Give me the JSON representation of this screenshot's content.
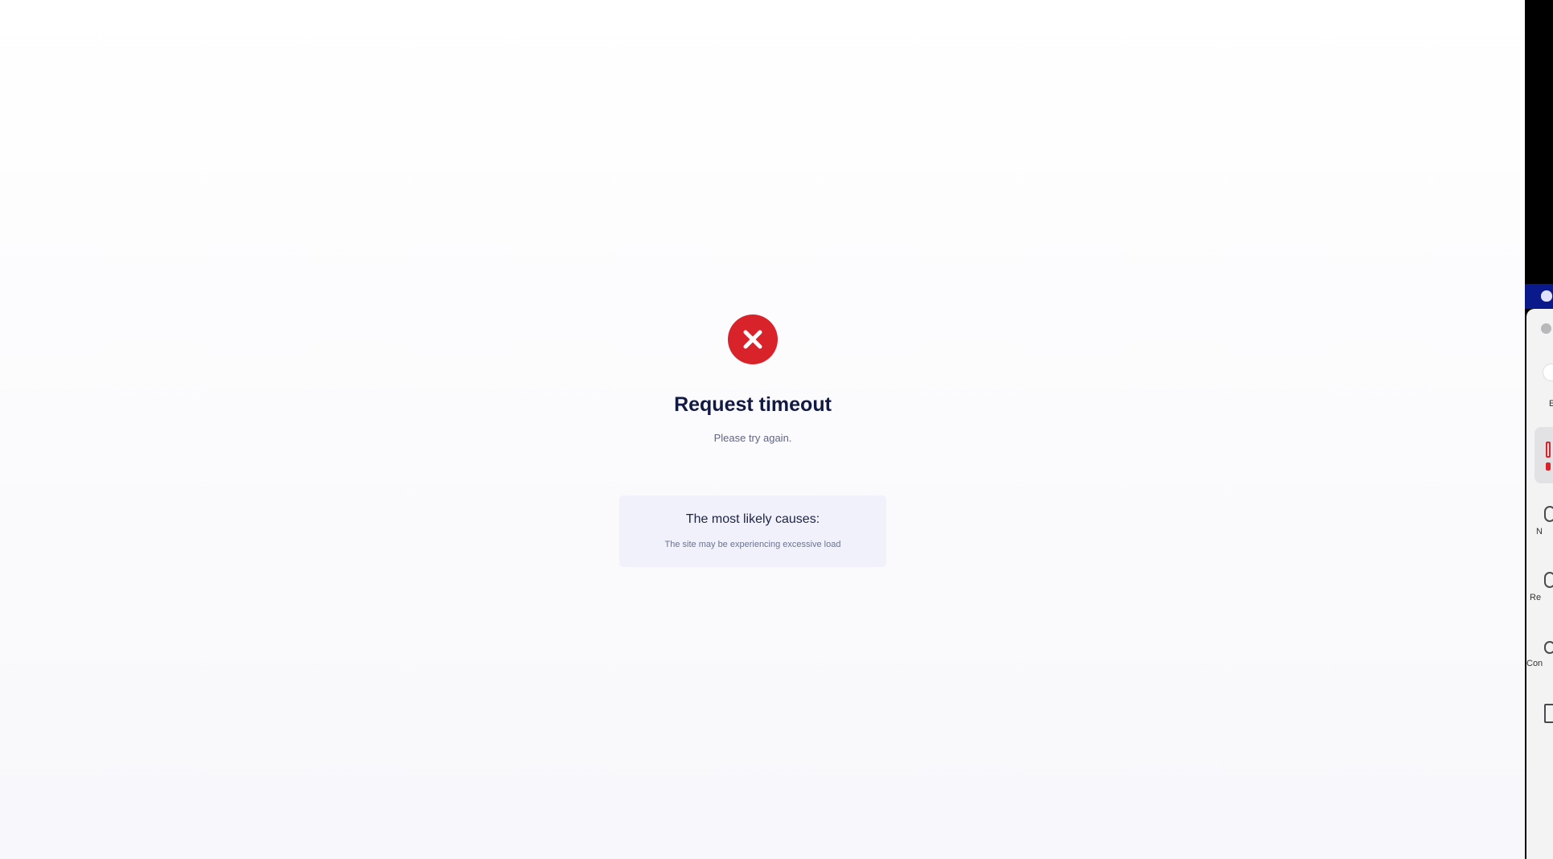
{
  "error": {
    "icon": "close-icon",
    "color": "#d9232a",
    "title": "Request timeout",
    "message": "Please try again."
  },
  "causes": {
    "heading": "The most likely causes:",
    "items": [
      "The site may be experiencing excessive load"
    ]
  },
  "side_window": {
    "badge_label": "E",
    "items": [
      {
        "label": "N",
        "icon": "clock-icon"
      },
      {
        "label": "Re",
        "icon": "clock-icon"
      },
      {
        "label": "Con",
        "icon": "contacts-icon"
      },
      {
        "label": "",
        "icon": "document-icon"
      }
    ]
  }
}
